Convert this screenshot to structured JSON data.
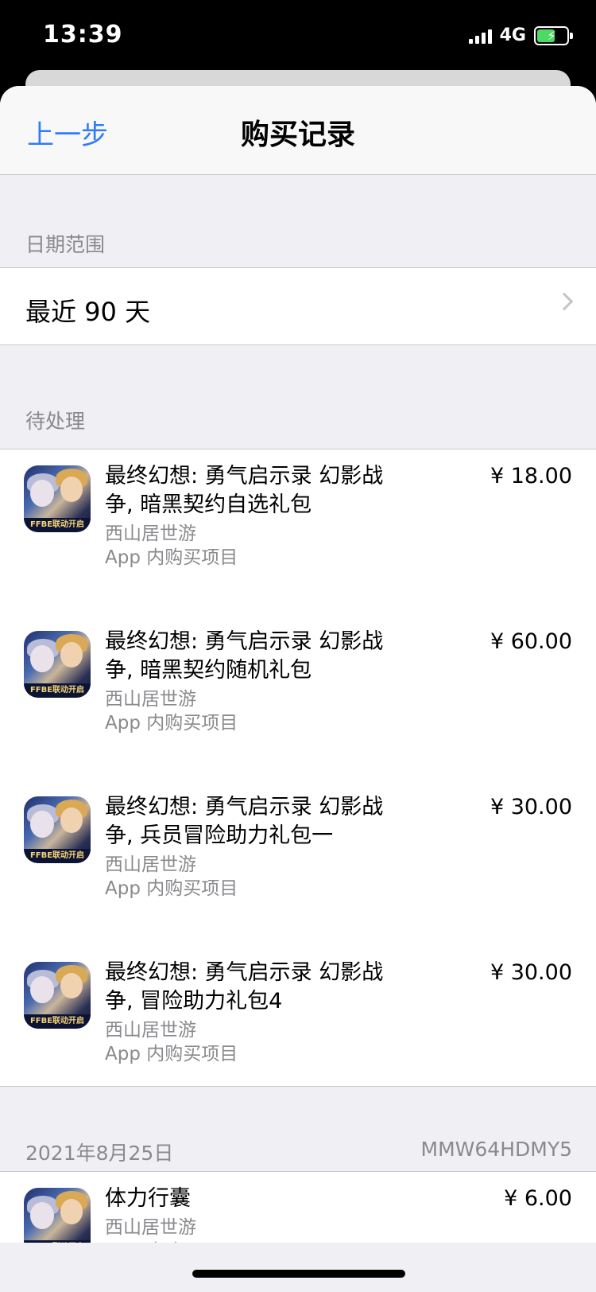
{
  "status_bar": {
    "time": "13:39",
    "network": "4G",
    "battery_charging": true
  },
  "nav": {
    "back_label": "上一步",
    "title": "购买记录"
  },
  "date_range": {
    "header": "日期范围",
    "value": "最近 90 天"
  },
  "pending": {
    "header": "待处理",
    "items": [
      {
        "title": "最终幻想: 勇气启示录 幻影战争, 暗黑契约自选礼包",
        "seller": "西山居世游",
        "type": "App 内购买项目",
        "price": "¥ 18.00"
      },
      {
        "title": "最终幻想: 勇气启示录 幻影战争, 暗黑契约随机礼包",
        "seller": "西山居世游",
        "type": "App 内购买项目",
        "price": "¥ 60.00"
      },
      {
        "title": "最终幻想: 勇气启示录 幻影战争, 兵员冒险助力礼包一",
        "seller": "西山居世游",
        "type": "App 内购买项目",
        "price": "¥ 30.00"
      },
      {
        "title": "最终幻想: 勇气启示录 幻影战争, 冒险助力礼包4",
        "seller": "西山居世游",
        "type": "App 内购买项目",
        "price": "¥ 30.00"
      }
    ]
  },
  "order": {
    "date": "2021年8月25日",
    "order_id": "MMW64HDMY5",
    "items": [
      {
        "title": "体力行囊",
        "seller": "西山居世游",
        "type": "App 内购买项目",
        "price": "¥ 6.00"
      }
    ]
  },
  "app_icon_banner": "FFBE联动开启",
  "colors": {
    "accent": "#2f7cf6",
    "secondary_text": "#8a8a8e",
    "background": "#efeff4"
  }
}
